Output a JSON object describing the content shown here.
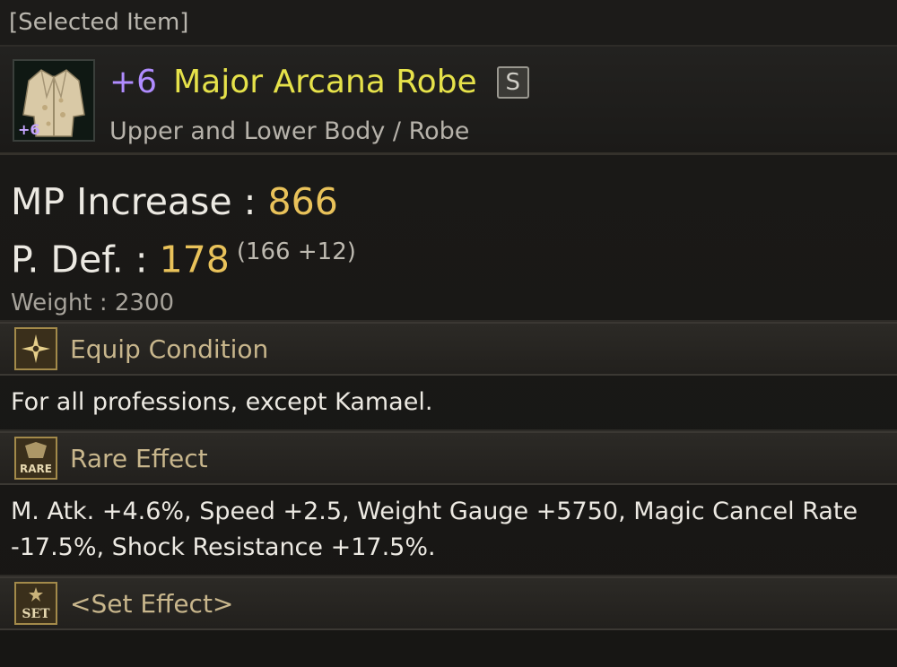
{
  "header": {
    "selected_label": "[Selected Item]"
  },
  "item": {
    "enchant": "+6",
    "icon_enchant": "+6",
    "name": "Major Arcana Robe",
    "grade": "S",
    "type": "Upper and Lower Body / Robe",
    "icon": "robe-icon"
  },
  "stats": {
    "mp_label": "MP Increase : ",
    "mp_value": "866",
    "pdef_label": "P. Def. : ",
    "pdef_value": "178",
    "pdef_breakdown": "(166 +12)",
    "weight": "Weight : 2300"
  },
  "equip": {
    "title": "Equip Condition",
    "icon": "equip-condition-icon",
    "text": "For all professions, except Kamael."
  },
  "rare": {
    "title": "Rare Effect",
    "icon": "rare-effect-icon",
    "icon_label": "RARE",
    "text": "M. Atk. +4.6%, Speed +2.5, Weight Gauge +5750, Magic Cancel Rate -17.5%, Shock Resistance +17.5%."
  },
  "set": {
    "title": "<Set Effect>",
    "icon": "set-effect-icon",
    "icon_label": "SET"
  },
  "colors": {
    "enchant": "#b08cff",
    "item_name": "#e6e24a",
    "stat_value": "#e9c25a",
    "section_title": "#c8b68c"
  }
}
